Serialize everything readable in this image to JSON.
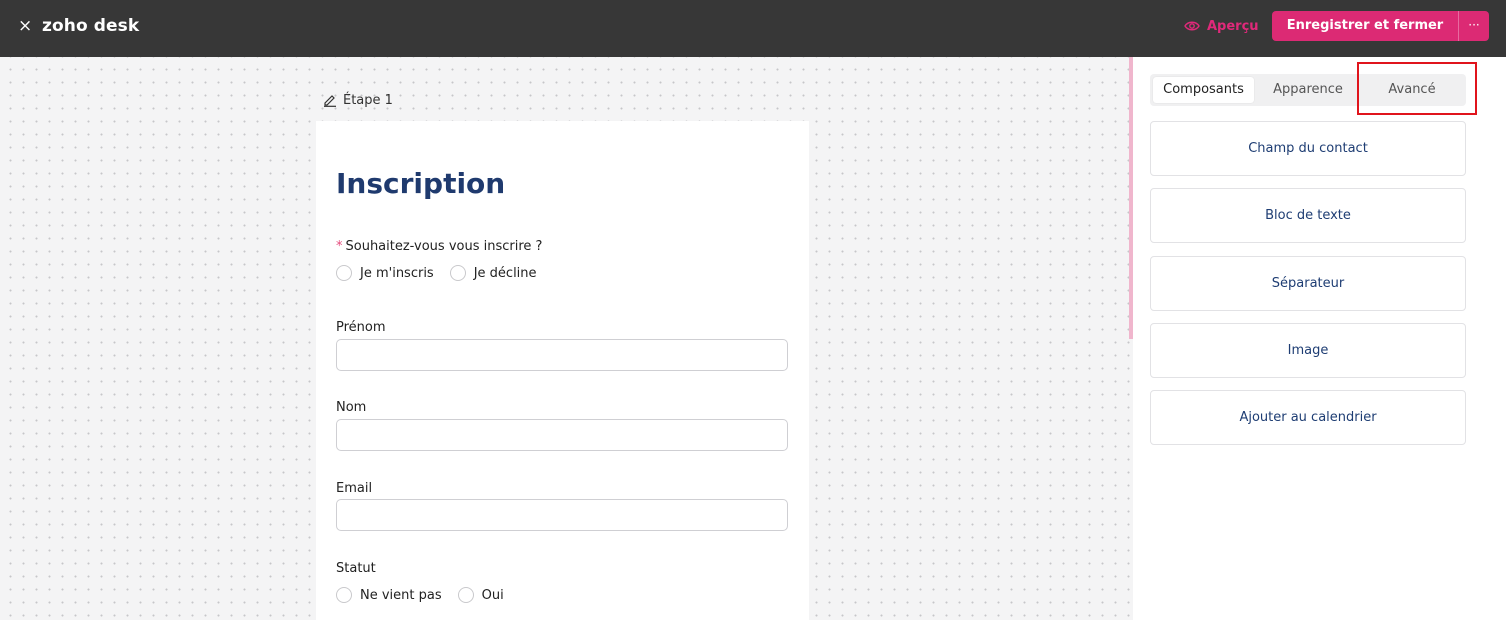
{
  "header": {
    "close_glyph": "×",
    "app_title": "zoho desk",
    "preview_label": "Aperçu",
    "save_label": "Enregistrer et fermer",
    "more_glyph": "···",
    "accent_color": "#dc2a74"
  },
  "canvas": {
    "step_label": "Étape 1",
    "form": {
      "title": "Inscription",
      "question1": {
        "required_mark": "*",
        "label": "Souhaitez-vous vous inscrire ?",
        "options": [
          "Je m'inscris",
          "Je décline"
        ]
      },
      "fields": [
        {
          "label": "Prénom",
          "value": ""
        },
        {
          "label": "Nom",
          "value": ""
        },
        {
          "label": "Email",
          "value": ""
        }
      ],
      "status": {
        "label": "Statut",
        "options": [
          "Ne vient pas",
          "Oui"
        ]
      }
    }
  },
  "panel": {
    "tabs": [
      {
        "label": "Composants",
        "active": true
      },
      {
        "label": "Apparence",
        "active": false
      },
      {
        "label": "Avancé",
        "active": false
      }
    ],
    "components": [
      "Champ du contact",
      "Bloc de texte",
      "Séparateur",
      "Image",
      "Ajouter au calendrier"
    ]
  }
}
